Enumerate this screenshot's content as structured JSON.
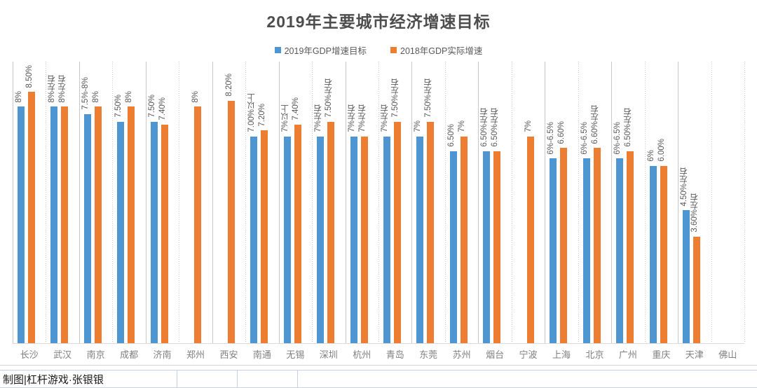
{
  "chart_data": {
    "type": "bar",
    "title": "2019年主要城市经济增速目标",
    "xlabel": "",
    "ylabel": "",
    "ylim": [
      0,
      9.5
    ],
    "grid": false,
    "legend_position": "top-center",
    "categories": [
      "长沙",
      "武汉",
      "南京",
      "成都",
      "济南",
      "郑州",
      "西安",
      "南通",
      "无锡",
      "深圳",
      "杭州",
      "青岛",
      "东莞",
      "苏州",
      "烟台",
      "宁波",
      "上海",
      "北京",
      "广州",
      "重庆",
      "天津",
      "佛山"
    ],
    "series": [
      {
        "name": "2019年GDP增速目标",
        "color": "#4e96d2",
        "values": [
          8,
          8,
          7.75,
          7.5,
          7.5,
          null,
          null,
          7.0,
          7.0,
          7.0,
          7.0,
          7.0,
          7.0,
          6.5,
          6.5,
          null,
          6.25,
          6.25,
          6.25,
          6.0,
          4.5,
          null
        ],
        "labels": [
          "8%",
          "8%左右",
          "7.5%-8%",
          "7.50%",
          "7.50%",
          "",
          "",
          "7.00%以上",
          "7%以上",
          "7%左右",
          "7%左右",
          "7%左右",
          "7%",
          "6.50%",
          "6.50%左右",
          "",
          "6%-6.5%",
          "6%-6.5%",
          "6%-6.5%",
          "6%",
          "4.50%左右",
          ""
        ]
      },
      {
        "name": "2018年GDP实际增速",
        "color": "#ed7d31",
        "values": [
          8.5,
          8,
          8,
          8,
          7.4,
          8,
          8.2,
          7.2,
          7.4,
          7.5,
          7.0,
          7.5,
          7.5,
          7.0,
          6.5,
          7.0,
          6.6,
          6.6,
          6.5,
          6.0,
          3.6,
          null
        ],
        "labels": [
          "8.50%",
          "8%左右",
          "8%",
          "8%",
          "7.40%",
          "8%",
          "8.20%",
          "7.20%",
          "7.40%",
          "7.50%左右",
          "7%左右",
          "7.50%左右",
          "7.50%左右",
          "7%",
          "6.50%左右",
          "7%",
          "6.60%",
          "6.60%左右",
          "6.50%左右",
          "6.00%",
          "3.60%左右",
          ""
        ]
      }
    ]
  },
  "legend": {
    "items": [
      {
        "label": "2019年GDP增速目标",
        "color": "#4e96d2"
      },
      {
        "label": "2018年GDP实际增速",
        "color": "#ed7d31"
      }
    ]
  },
  "sheet": {
    "credit": "制图|杠杆游戏·张银银",
    "cell2": "",
    "cell3": "",
    "cell4": ""
  }
}
